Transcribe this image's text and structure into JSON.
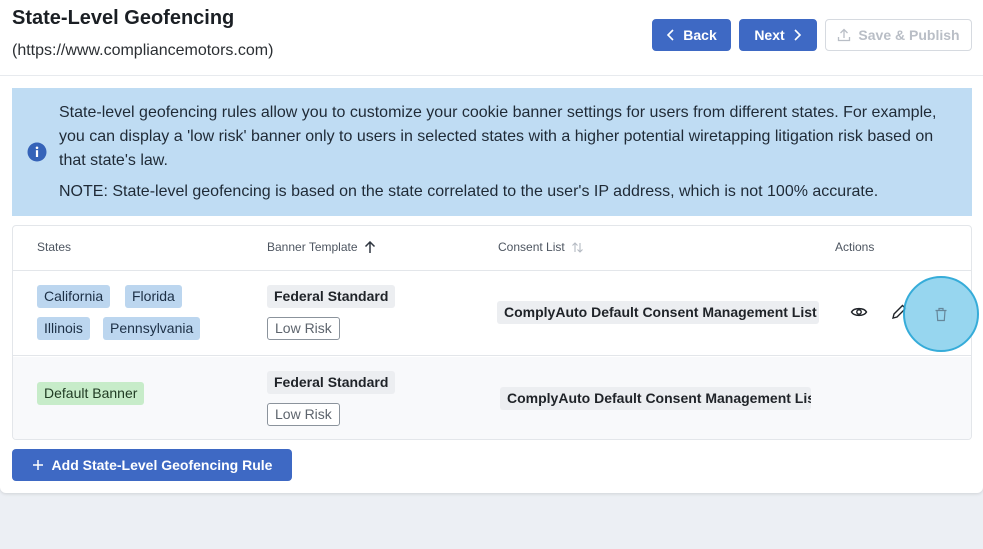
{
  "header": {
    "title": "State-Level Geofencing",
    "subtitle": "(https://www.compliancemotors.com)",
    "back_label": "Back",
    "next_label": "Next",
    "save_label": "Save & Publish"
  },
  "info": {
    "paragraph1": "State-level geofencing rules allow you to customize your cookie banner settings for users from different states. For example, you can display a 'low risk' banner only to users in selected states with a higher potential wiretapping litigation risk based on that state's law.",
    "paragraph2": "NOTE: State-level geofencing is based on the state correlated to the user's IP address, which is not 100% accurate."
  },
  "table": {
    "columns": [
      "States",
      "Banner Template",
      "Consent List",
      "Actions"
    ],
    "rows": [
      {
        "states": [
          "California",
          "Florida",
          "Illinois",
          "Pennsylvania"
        ],
        "template": "Federal Standard",
        "risk": "Low Risk",
        "consent_list": "ComplyAuto Default Consent Management List"
      },
      {
        "states": [
          "Default Banner"
        ],
        "template": "Federal Standard",
        "risk": "Low Risk",
        "consent_list": "ComplyAuto Default Consent Management List"
      }
    ]
  },
  "add_rule_label": "Add State-Level Geofencing Rule",
  "colors": {
    "primary": "#3e69c4",
    "info_bg": "#bfdcf3",
    "state_tag": "#bcd6ef",
    "default_tag": "#c7ecc9",
    "highlight": "#8fd3ee"
  },
  "icons": [
    "chevron-left-icon",
    "chevron-right-icon",
    "upload-icon",
    "info-icon",
    "sort-up-icon",
    "sort-icon",
    "eye-icon",
    "pencil-icon",
    "trash-icon",
    "plus-icon"
  ]
}
